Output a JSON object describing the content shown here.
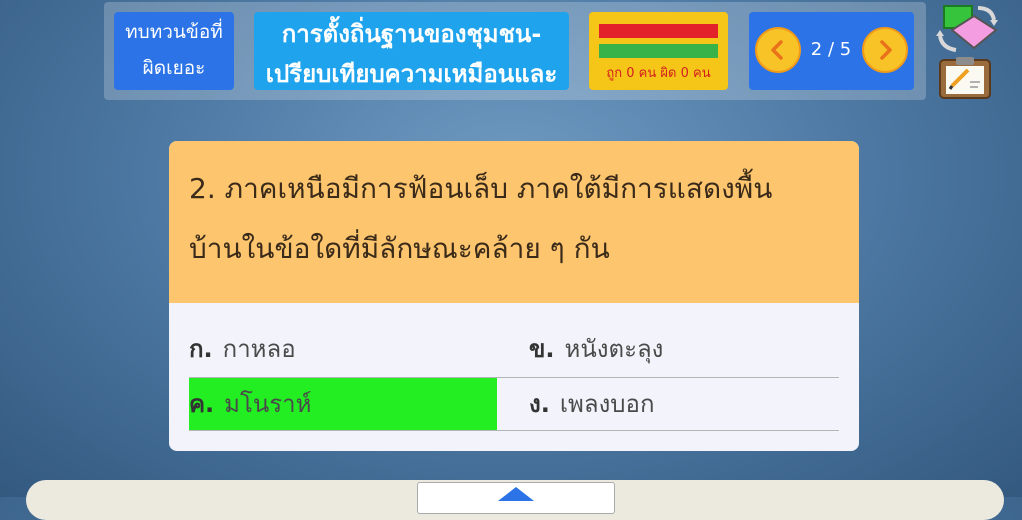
{
  "header": {
    "review_button": [
      "ทบทวนข้อที่",
      "ผิดเยอะ"
    ],
    "lesson_title": [
      "การตั้งถิ่นฐานของชุมชน-",
      "เปรียบเทียบความเหมือนและ"
    ],
    "score": {
      "text": "ถูก 0 คน ผิด 0 คน",
      "bar_colors": [
        "#e3212b",
        "#37b34a"
      ]
    },
    "navigation": {
      "page_indicator": "2 / 5",
      "prev_icon": "chevron-left-icon",
      "next_icon": "chevron-right-icon"
    },
    "tools": {
      "shuffle_icon": "shuffle-cards-icon",
      "notes_icon": "clipboard-notes-icon"
    }
  },
  "question": {
    "line1": "2. ภาคเหนือมีการฟ้อนเล็บ ภาคใต้มีการแสดงพื้น",
    "line2": "บ้านในข้อใดที่มีลักษณะคล้าย ๆ กัน"
  },
  "options": [
    {
      "label": "ก.",
      "text": "กาหลอ",
      "selected": false
    },
    {
      "label": "ข.",
      "text": "หนังตะลุง",
      "selected": false
    },
    {
      "label": "ค.",
      "text": "มโนราห์",
      "selected": true
    },
    {
      "label": "ง.",
      "text": "เพลงบอก",
      "selected": false
    }
  ],
  "colors": {
    "selected_option": "#22ee22",
    "question_bg": "#fdc56e",
    "header_blue": "#2b73e6"
  }
}
